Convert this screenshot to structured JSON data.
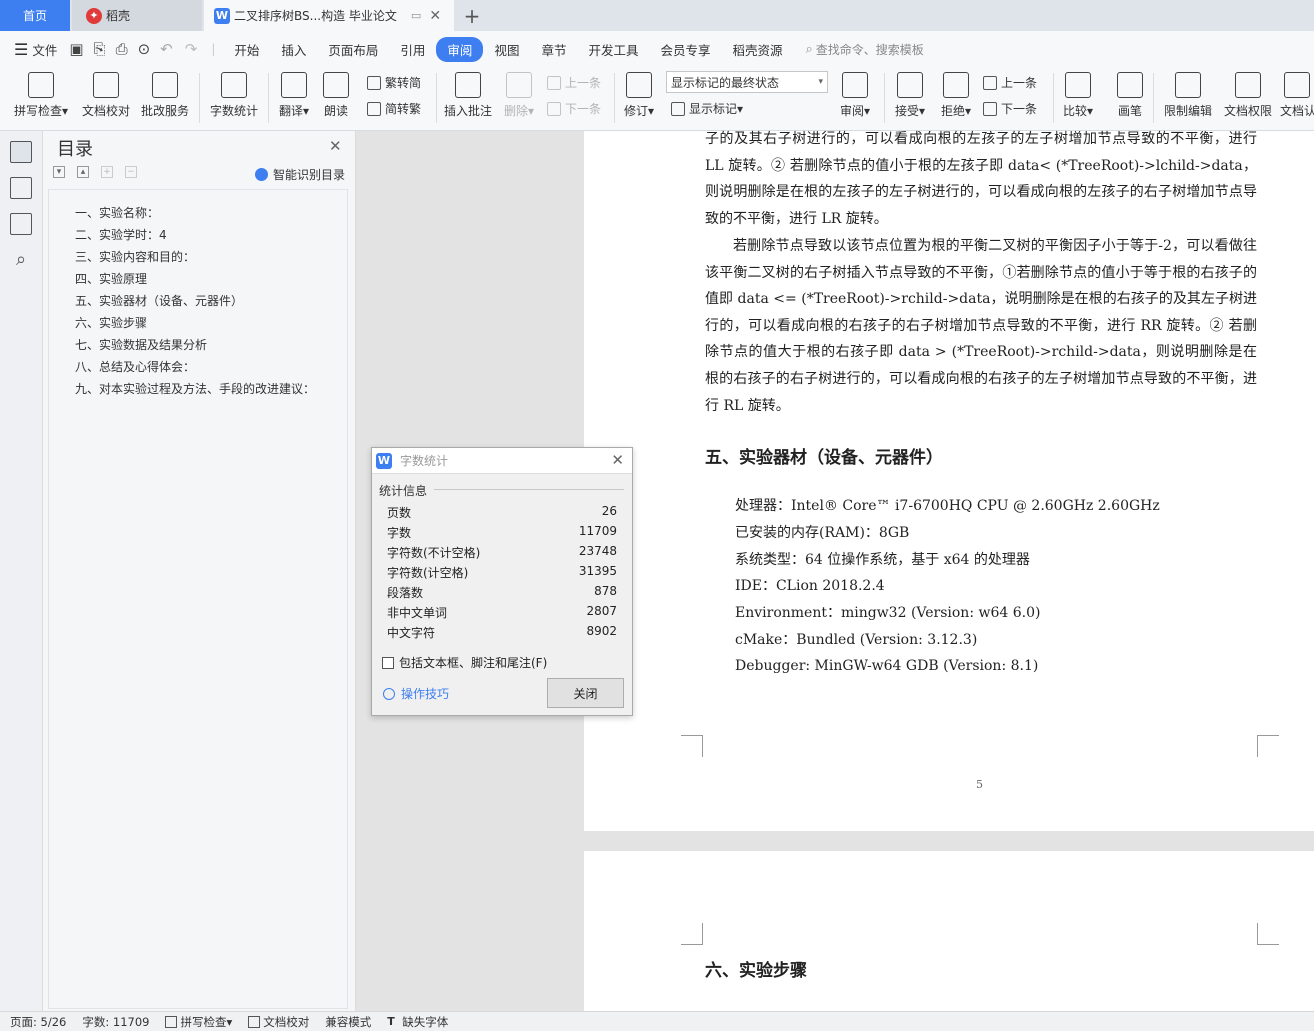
{
  "tabs": {
    "home": "首页",
    "daoke": "稻壳",
    "doc": "二叉排序树BS...构造 毕业论文"
  },
  "menu": {
    "file": "文件",
    "items": [
      "开始",
      "插入",
      "页面布局",
      "引用",
      "审阅",
      "视图",
      "章节",
      "开发工具",
      "会员专享",
      "稻壳资源"
    ],
    "active_index": 4,
    "search_placeholder": "查找命令、搜索模板"
  },
  "ribbon": {
    "spell": "拼写检查",
    "proofread": "文档校对",
    "revise_service": "批改服务",
    "word_count": "字数统计",
    "translate": "翻译",
    "read_aloud": "朗读",
    "trad_to_simp": "繁转简",
    "simp_to_trad": "简转繁",
    "insert_comment": "插入批注",
    "delete": "删除",
    "prev_comment": "上一条",
    "next_comment": "下一条",
    "track": "修订",
    "track_state": "显示标记的最终状态",
    "show_markup": "显示标记",
    "review": "审阅",
    "accept": "接受",
    "reject": "拒绝",
    "prev_change": "上一条",
    "next_change": "下一条",
    "compare": "比较",
    "ink": "画笔",
    "restrict": "限制编辑",
    "permission": "文档权限",
    "auth": "文档认"
  },
  "toc": {
    "title": "目录",
    "smart": "智能识别目录",
    "items": [
      "一、实验名称：",
      "二、实验学时：4",
      "三、实验内容和目的：",
      "四、实验原理",
      "五、实验器材（设备、元器件）",
      "六、实验步骤",
      "七、实验数据及结果分析",
      "八、总结及心得体会：",
      "九、对本实验过程及方法、手段的改进建议："
    ]
  },
  "doc": {
    "p1": "子的及其右子树进行的，可以看成向根的左孩子的左子树增加节点导致的不平衡，进行 LL 旋转。② 若删除节点的值小于根的左孩子即 data< (*TreeRoot)->lchild->data，则说明删除是在根的左孩子的左子树进行的，可以看成向根的左孩子的右子树增加节点导致的不平衡，进行 LR 旋转。",
    "p2": "若删除节点导致以该节点位置为根的平衡二叉树的平衡因子小于等于-2，可以看做往该平衡二叉树的右子树插入节点导致的不平衡，①若删除节点的值小于等于根的右孩子的值即 data <= (*TreeRoot)->rchild->data，说明删除是在根的右孩子的及其左子树进行的，可以看成向根的右孩子的右子树增加节点导致的不平衡，进行 RR 旋转。② 若删除节点的值大于根的右孩子即 data > (*TreeRoot)->rchild->data，则说明删除是在根的右孩子的右子树进行的，可以看成向根的右孩子的左子树增加节点导致的不平衡，进行 RL 旋转。",
    "h5": "五、实验器材（设备、元器件）",
    "specs": [
      "处理器：Intel® Core™ i7-6700HQ CPU @ 2.60GHz   2.60GHz",
      "已安装的内存(RAM)：8GB",
      "系统类型：64 位操作系统，基于 x64 的处理器",
      "IDE：CLion 2018.2.4",
      "Environment：mingw32 (Version: w64 6.0)",
      "cMake：Bundled (Version: 3.12.3)",
      "Debugger: MinGW-w64 GDB (Version: 8.1)"
    ],
    "page_number": "5",
    "h6": "六、实验步骤"
  },
  "dialog": {
    "title": "字数统计",
    "section": "统计信息",
    "rows": [
      {
        "k": "页数",
        "v": "26"
      },
      {
        "k": "字数",
        "v": "11709"
      },
      {
        "k": "字符数(不计空格)",
        "v": "23748"
      },
      {
        "k": "字符数(计空格)",
        "v": "31395"
      },
      {
        "k": "段落数",
        "v": "878"
      },
      {
        "k": "非中文单词",
        "v": "2807"
      },
      {
        "k": "中文字符",
        "v": "8902"
      }
    ],
    "checkbox": "包括文本框、脚注和尾注(F)",
    "tips": "操作技巧",
    "close": "关闭"
  },
  "status": {
    "page": "页面: 5/26",
    "words": "字数: 11709",
    "spell": "拼写检查",
    "proof": "文档校对",
    "compat": "兼容模式",
    "font": "缺失字体"
  },
  "colors": {
    "accent": "#3d7ef0"
  }
}
